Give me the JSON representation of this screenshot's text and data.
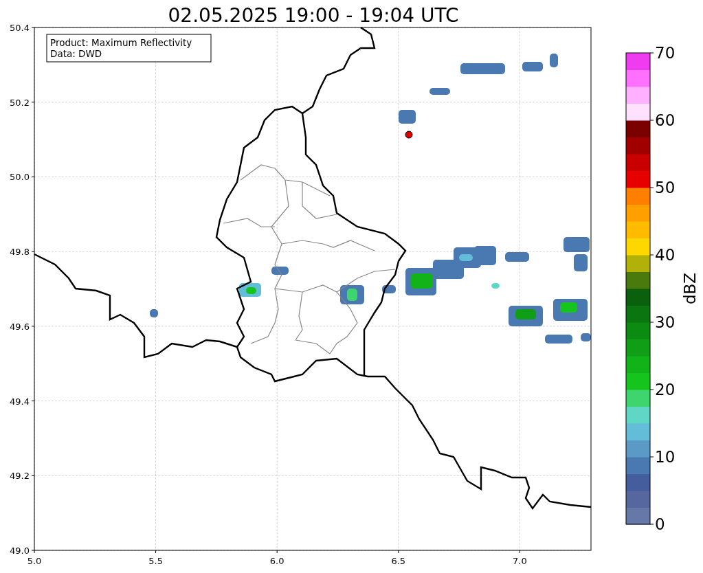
{
  "title": "02.05.2025 19:00 - 19:04 UTC",
  "legend": {
    "lines": [
      "Product: Maximum Reflectivity",
      "Data: DWD"
    ]
  },
  "x_axis": {
    "ticks": [
      "5.0",
      "5.5",
      "6.0",
      "6.5",
      "7.0"
    ]
  },
  "y_axis": {
    "ticks": [
      "50.4",
      "50.2",
      "50.0",
      "49.8",
      "49.6",
      "49.4",
      "49.2",
      "49.0"
    ]
  },
  "colorbar": {
    "label": "dBZ",
    "ticks": [
      "70",
      "60",
      "50",
      "40",
      "30",
      "20",
      "10",
      "0"
    ],
    "bands": [
      {
        "color": "#6678a8"
      },
      {
        "color": "#5667a0"
      },
      {
        "color": "#445d9c"
      },
      {
        "color": "#4a78b0"
      },
      {
        "color": "#5b9ac6"
      },
      {
        "color": "#63bcd8"
      },
      {
        "color": "#5fd6c6"
      },
      {
        "color": "#3ed56e"
      },
      {
        "color": "#15c51d"
      },
      {
        "color": "#12b219"
      },
      {
        "color": "#0f9e16"
      },
      {
        "color": "#0c8b12"
      },
      {
        "color": "#0b750f"
      },
      {
        "color": "#0a600d"
      },
      {
        "color": "#4a7a0e"
      },
      {
        "color": "#b1b10a"
      },
      {
        "color": "#ffd700"
      },
      {
        "color": "#ffbb00"
      },
      {
        "color": "#ff9f00"
      },
      {
        "color": "#ff8000"
      },
      {
        "color": "#e60000"
      },
      {
        "color": "#c80000"
      },
      {
        "color": "#a00000"
      },
      {
        "color": "#7b0000"
      },
      {
        "color": "#ffe0ff"
      },
      {
        "color": "#ffb0ff"
      },
      {
        "color": "#ff70ff"
      },
      {
        "color": "#f03cf0"
      }
    ]
  }
}
